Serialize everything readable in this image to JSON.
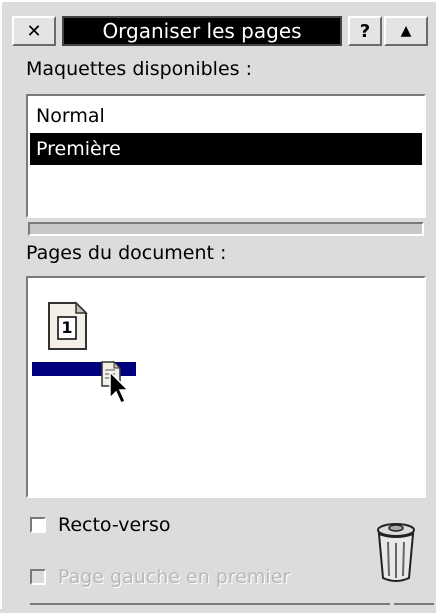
{
  "window": {
    "title": "Organiser les pages",
    "close_label": "✕",
    "help_label": "?",
    "shade_label": "▲"
  },
  "layouts": {
    "heading": "Maquettes disponibles :",
    "items": [
      {
        "label": "Normal",
        "selected": false
      },
      {
        "label": "Première",
        "selected": true
      }
    ]
  },
  "pages": {
    "heading": "Pages du document :",
    "items": [
      {
        "number": "1"
      }
    ]
  },
  "options": {
    "recto_verso": {
      "label": "Recto-verso",
      "checked": false,
      "enabled": true
    },
    "left_first": {
      "label": "Page gauche en premier",
      "checked": false,
      "enabled": false
    }
  },
  "icons": {
    "trash": "trash-icon",
    "page": "page-icon",
    "cursor": "mouse-pointer-icon"
  },
  "colors": {
    "selection": "#000000",
    "drop_marker": "#00007f"
  }
}
